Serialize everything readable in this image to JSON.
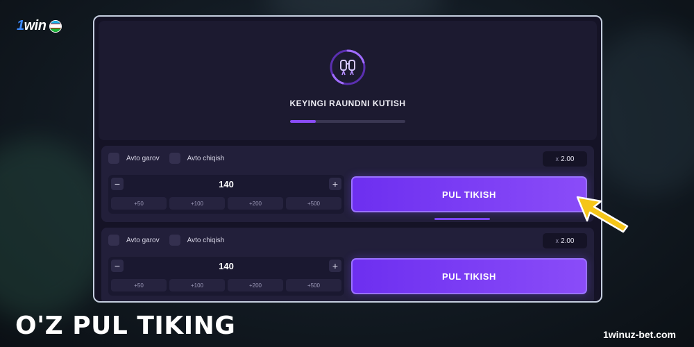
{
  "brand": {
    "logo_one": "1",
    "logo_win": "win",
    "flag_icon": "uzbekistan-flag-icon"
  },
  "round": {
    "status": "KEYINGI RAUNDNI KUTISH",
    "icon": "jetpack-icon",
    "progress": 0.22
  },
  "bets": [
    {
      "auto_bet_label": "Avto garov",
      "auto_cashout_label": "Avto chiqish",
      "multiplier_prefix": "x",
      "multiplier": "2.00",
      "amount": "140",
      "minus": "−",
      "plus": "+",
      "quick_amounts": [
        "+50",
        "+100",
        "+200",
        "+500"
      ],
      "button_label": "PUL TIKISH"
    },
    {
      "auto_bet_label": "Avto garov",
      "auto_cashout_label": "Avto chiqish",
      "multiplier_prefix": "x",
      "multiplier": "2.00",
      "amount": "140",
      "minus": "−",
      "plus": "+",
      "quick_amounts": [
        "+50",
        "+100",
        "+200",
        "+500"
      ],
      "button_label": "PUL TIKISH"
    }
  ],
  "caption": {
    "headline": "O'Z PUL TIKING",
    "site": "1winuz-bet.com"
  },
  "colors": {
    "accent": "#8a4cf5",
    "pointer": "#f5c518"
  }
}
